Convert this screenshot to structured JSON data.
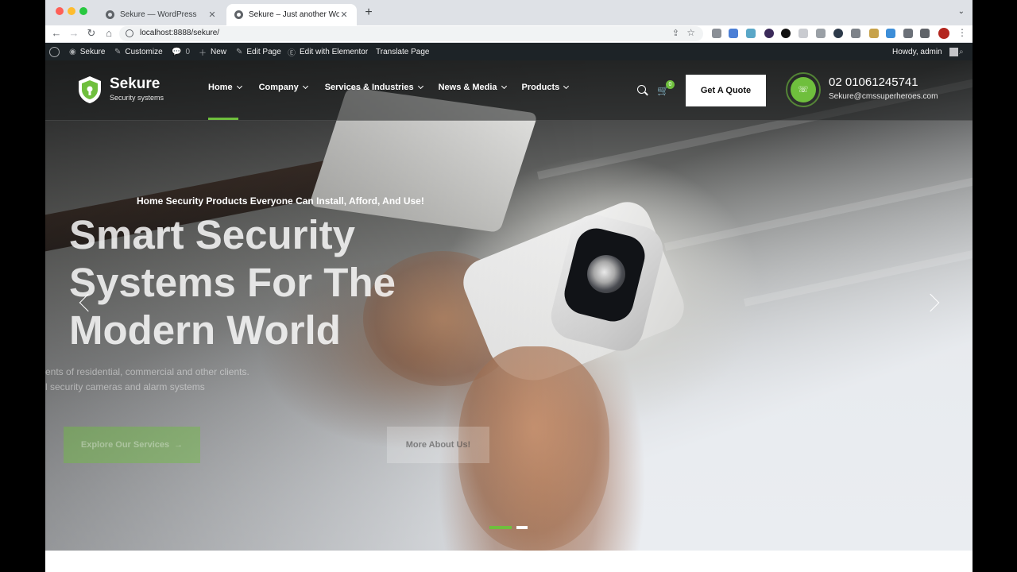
{
  "browser": {
    "tabs": [
      {
        "title": "Sekure — WordPress",
        "active": false
      },
      {
        "title": "Sekure – Just another WordPress site",
        "active": true
      }
    ],
    "url": "localhost:8888/sekure/"
  },
  "admin_bar": {
    "site": "Sekure",
    "customize": "Customize",
    "comments_count": "0",
    "new": "New",
    "edit_page": "Edit Page",
    "elementor": "Edit with Elementor",
    "translate": "Translate Page",
    "howdy": "Howdy, admin"
  },
  "header": {
    "logo_name": "Sekure",
    "logo_tagline": "Security systems",
    "nav": [
      "Home",
      "Company",
      "Services & Industries",
      "News & Media",
      "Products"
    ],
    "cart_count": "0",
    "quote_button": "Get A Quote",
    "phone": "02 01061245741",
    "email": "Sekure@cmssuperheroes.com"
  },
  "hero": {
    "eyebrow": "Home Security Products Everyone Can Install, Afford, And Use!",
    "title_lines": [
      "Smart Security",
      "Systems For The",
      "Modern World"
    ],
    "desc_line1": "ents of residential, commercial and other clients.",
    "desc_line2": "l security cameras and alarm systems",
    "btn_explore": "Explore Our Services",
    "btn_about": "More About Us!"
  },
  "colors": {
    "accent": "#6fbf3d",
    "admin_bar": "#1d2327"
  }
}
